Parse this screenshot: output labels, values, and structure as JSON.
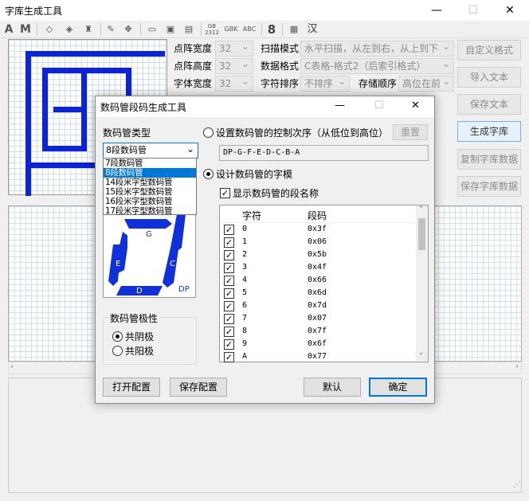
{
  "window": {
    "title": "字库生成工具",
    "minimize": "—",
    "maximize": "☐",
    "close": "✕"
  },
  "toolbar": {
    "items": [
      "A",
      "M",
      "GB 2312",
      "GBK",
      "ABC",
      "8",
      "汉"
    ]
  },
  "settings": {
    "dot_width": {
      "label": "点阵宽度",
      "value": "32"
    },
    "dot_height": {
      "label": "点阵高度",
      "value": "32"
    },
    "font_width": {
      "label": "字体宽度",
      "value": "32"
    },
    "scan_mode": {
      "label": "扫描模式",
      "value": "水平扫描，从左到右，从上到下"
    },
    "data_format": {
      "label": "数据格式",
      "value": "C表格-格式2（后索引格式）"
    },
    "char_sort": {
      "label": "字符排序",
      "value": "不排序"
    },
    "storage_order": {
      "label": "存储顺序",
      "value": "高位在前"
    }
  },
  "right_buttons": {
    "custom_format": "自定义格式",
    "import_text": "导入文本",
    "save_text": "保存文本",
    "generate": "生成字库",
    "copy_data": "复制字库数据",
    "save_data": "保存字库数据"
  },
  "dialog": {
    "title": "数码管段码生成工具",
    "minimize": "—",
    "maximize": "☐",
    "close": "✕",
    "type_label": "数码管类型",
    "type_selected": "8段数码管",
    "type_options": [
      "7段数码管",
      "8段数码管",
      "14段米字型数码管",
      "15段米字型数码管",
      "16段米字型数码管",
      "17段米字型数码管"
    ],
    "seg_labels": {
      "g": "G",
      "e": "E",
      "c": "C",
      "d": "D",
      "dp": "DP"
    },
    "polarity_label": "数码管极性",
    "common_cathode": "共阴极",
    "common_anode": "共阳极",
    "order_radio": "设置数码管的控制次序（从低位到高位）",
    "reset": "重置",
    "order_value": "DP-G-F-E-D-C-B-A",
    "design_radio": "设计数码管的字模",
    "show_names": "显示数码管的段名称",
    "col_char": "字符",
    "col_code": "段码",
    "rows": [
      {
        "char": "0",
        "code": "0x3f"
      },
      {
        "char": "1",
        "code": "0x06"
      },
      {
        "char": "2",
        "code": "0x5b"
      },
      {
        "char": "3",
        "code": "0x4f"
      },
      {
        "char": "4",
        "code": "0x66"
      },
      {
        "char": "5",
        "code": "0x6d"
      },
      {
        "char": "6",
        "code": "0x7d"
      },
      {
        "char": "7",
        "code": "0x07"
      },
      {
        "char": "8",
        "code": "0x7f"
      },
      {
        "char": "9",
        "code": "0x6f"
      },
      {
        "char": "A",
        "code": "0x77"
      }
    ],
    "open_config": "打开配置",
    "save_config": "保存配置",
    "default": "默认",
    "confirm": "确定"
  }
}
